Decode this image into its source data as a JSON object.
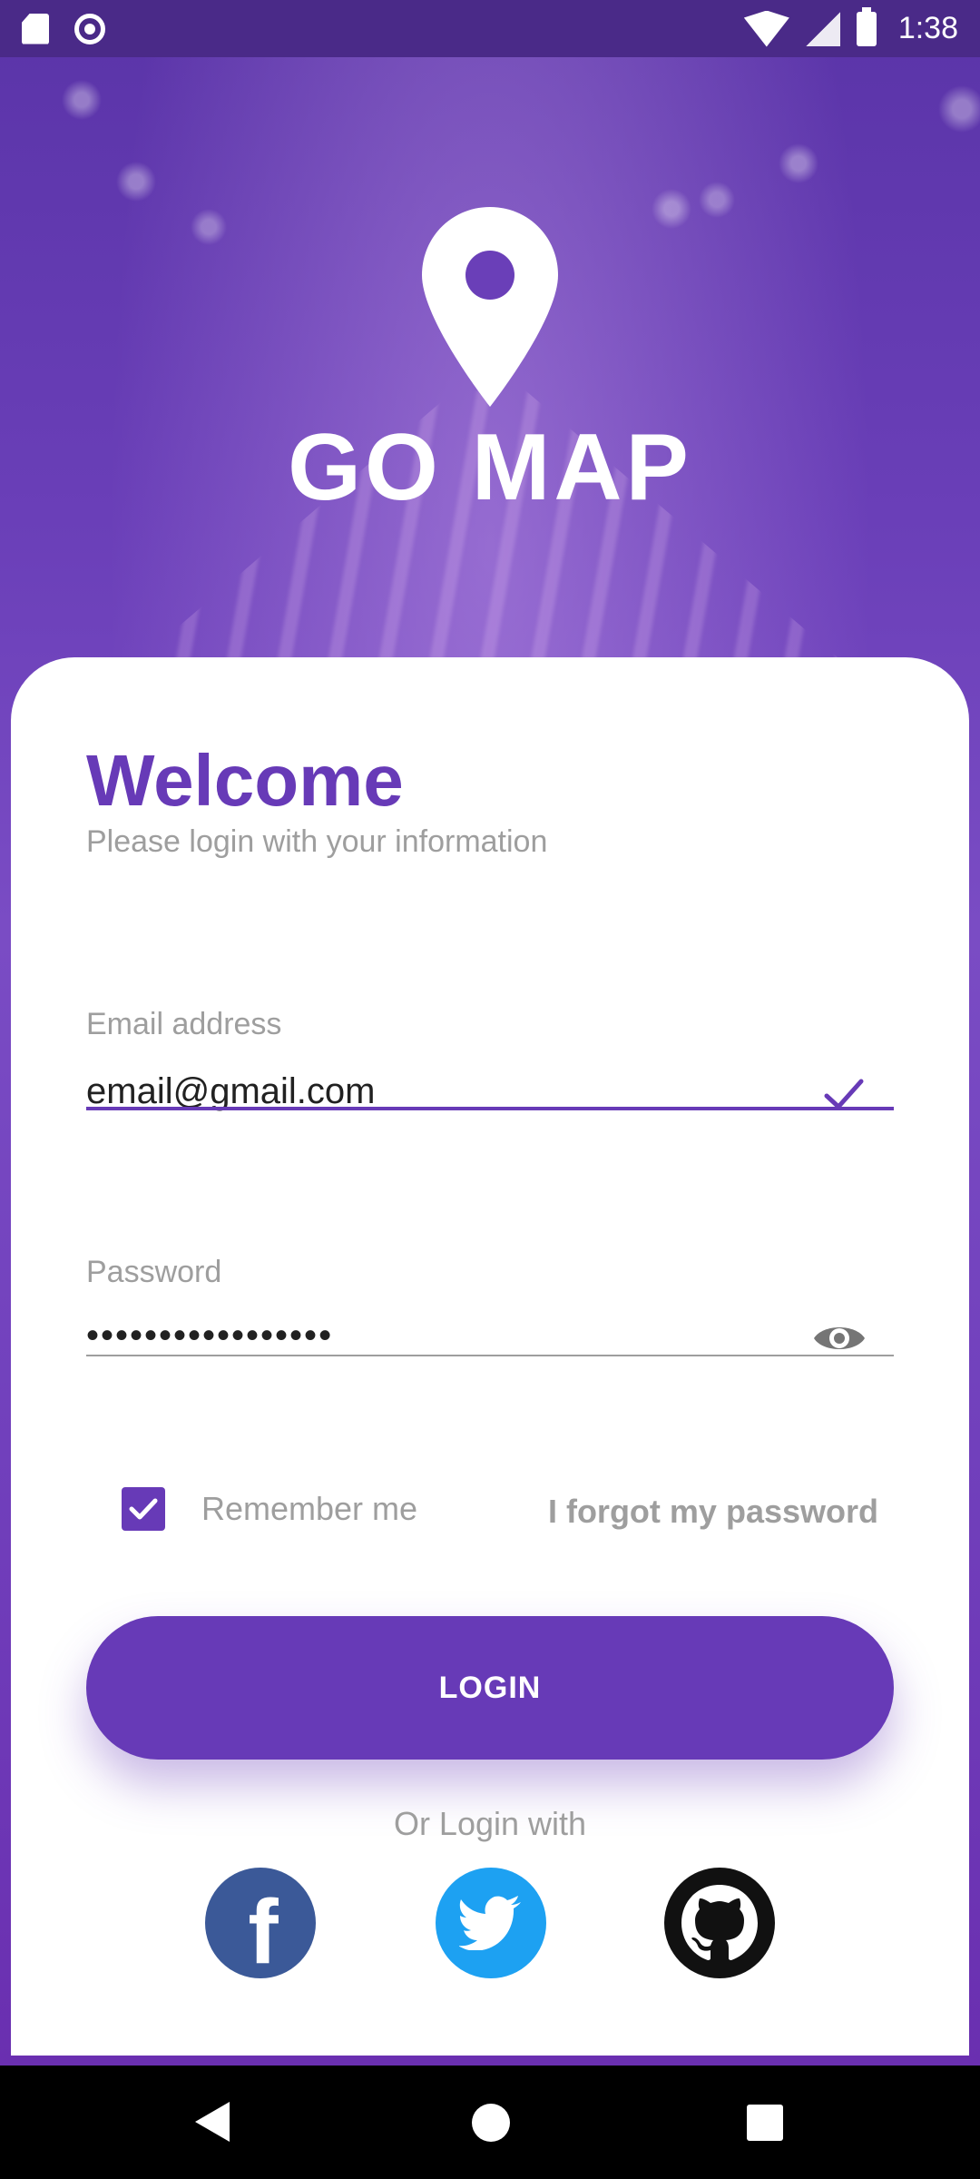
{
  "status_bar": {
    "time": "1:38",
    "icons": [
      "sd-card-icon",
      "record-icon",
      "wifi-icon",
      "signal-icon",
      "battery-icon"
    ]
  },
  "app": {
    "brand": "GO MAP",
    "logo_icon": "location-pin-icon"
  },
  "login_card": {
    "title": "Welcome",
    "subtitle": "Please login with your information",
    "email": {
      "label": "Email address",
      "value": "email@gmail.com",
      "valid_icon": "check-icon"
    },
    "password": {
      "label": "Password",
      "value": "•••••••••••••••••",
      "toggle_icon": "eye-icon"
    },
    "remember_me": {
      "label": "Remember me",
      "checked": true
    },
    "forgot_password": "I forgot my password",
    "login_button": "LOGIN",
    "alt_login_text": "Or Login with",
    "social": [
      "facebook-icon",
      "twitter-icon",
      "github-icon"
    ]
  },
  "colors": {
    "accent": "#673ab7",
    "facebook": "#3b5998",
    "twitter": "#1da1f2",
    "github": "#111111"
  },
  "nav_bar": {
    "buttons": [
      "back-icon",
      "home-icon",
      "recents-icon"
    ]
  }
}
